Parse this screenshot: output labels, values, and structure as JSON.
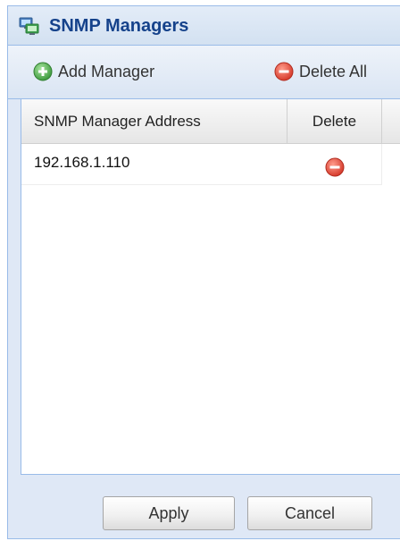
{
  "window": {
    "title": "SNMP Managers",
    "title_icon": "network-computers-icon"
  },
  "toolbar": {
    "add_label": "Add Manager",
    "add_icon": "add-circle-icon",
    "delete_all_label": "Delete All",
    "delete_all_icon": "delete-circle-icon"
  },
  "grid": {
    "columns": [
      "SNMP Manager Address",
      "Delete"
    ],
    "rows": [
      {
        "address": "192.168.1.110",
        "delete_icon": "delete-circle-icon"
      }
    ]
  },
  "footer": {
    "apply_label": "Apply",
    "cancel_label": "Cancel"
  },
  "colors": {
    "title_text": "#15428b",
    "panel_border": "#99bbe8",
    "add_green": "#5cb85c",
    "delete_red": "#e0473b"
  }
}
